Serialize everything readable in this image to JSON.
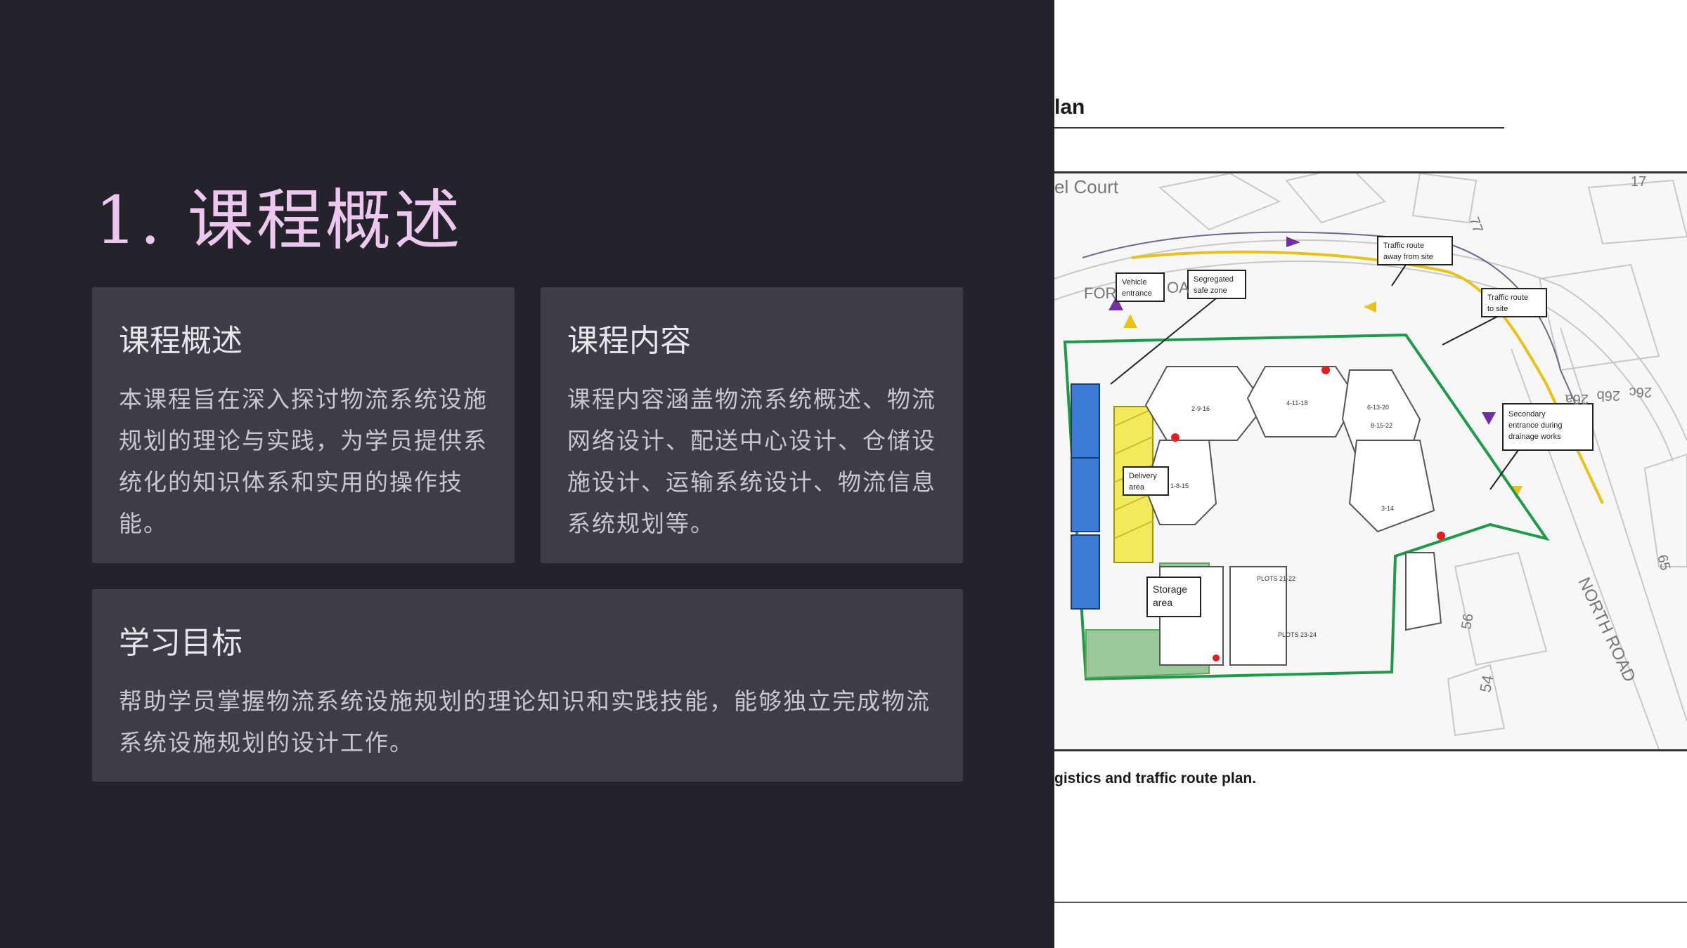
{
  "slide": {
    "title": "1.  课程概述",
    "cards": {
      "overview": {
        "title": "课程概述",
        "body": "本课程旨在深入探讨物流系统设施规划的理论与实践，为学员提供系统化的知识体系和实用的操作技能。"
      },
      "content": {
        "title": "课程内容",
        "body": "课程内容涵盖物流系统概述、物流网络设计、配送中心设计、仓储设施设计、运输系统设计、物流信息系统规划等。"
      },
      "goals": {
        "title": "学习目标",
        "body": "帮助学员掌握物流系统设施规划的理论知识和实践技能，能够独立完成物流系统设施规划的设计工作。"
      }
    }
  },
  "document": {
    "heading": "lan",
    "caption": "gistics and traffic route plan.",
    "map": {
      "labels": {
        "court": "el Court",
        "road_partial": "FOR",
        "road_partial2": "OA",
        "north_road": "NORTH ROAD",
        "num_65": "65",
        "num_54": "54",
        "num_56": "56",
        "num_17": "17",
        "num_77": "77",
        "house_a": "26a",
        "house_b": "26b",
        "house_c": "26c"
      },
      "callouts": {
        "vehicle_entrance": [
          "Vehicle",
          "entrance"
        ],
        "segregated_safe_zone": [
          "Segregated",
          "safe zone"
        ],
        "traffic_away": [
          "Traffic route",
          "away from site"
        ],
        "traffic_to": [
          "Traffic route",
          "to site"
        ],
        "secondary_entrance": [
          "Secondary",
          "entrance during",
          "drainage works"
        ],
        "delivery_area": [
          "Delivery",
          "area"
        ],
        "storage_area": [
          "Storage",
          "area"
        ]
      },
      "plots": [
        "2-9-16",
        "4-11-18",
        "6-13-20",
        "8-15-22",
        "1-8-15",
        "3-14",
        "PLOTS 21-22",
        "PLOTS 23-24"
      ]
    },
    "colors": {
      "site_boundary": "#1f9a4a",
      "traffic_to": "#e8c21c",
      "traffic_away": "#7030a0",
      "storage_fill": "#5aa85a",
      "delivery_fill": "#f2ea5a",
      "parking_fill": "#3a7bd5",
      "marker": "#e02020"
    }
  }
}
